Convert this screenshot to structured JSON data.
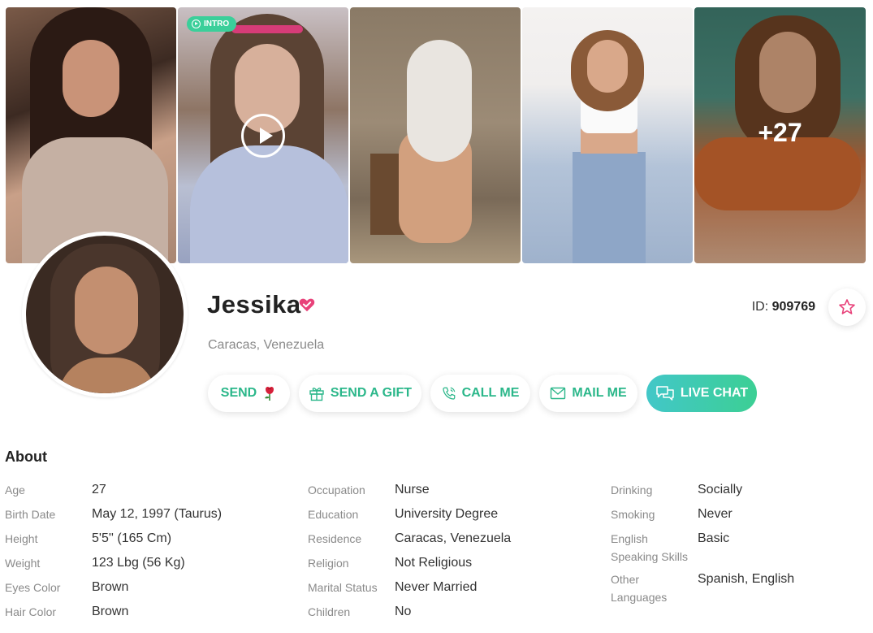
{
  "gallery": {
    "intro_badge": "INTRO",
    "more_count": "+27"
  },
  "profile": {
    "name": "Jessika",
    "location": "Caracas, Venezuela",
    "id_label": "ID:",
    "id_value": "909769"
  },
  "actions": {
    "send": "SEND",
    "send_gift": "SEND A GIFT",
    "call_me": "CALL ME",
    "mail_me": "MAIL ME",
    "live_chat": "LIVE CHAT"
  },
  "about": {
    "title": "About",
    "col1": [
      {
        "label": "Age",
        "value": "27"
      },
      {
        "label": "Birth Date",
        "value": "May 12, 1997 (Taurus)"
      },
      {
        "label": "Height",
        "value": "5'5'' (165 Cm)"
      },
      {
        "label": "Weight",
        "value": "123 Lbg (56 Kg)"
      },
      {
        "label": "Eyes Color",
        "value": "Brown"
      },
      {
        "label": "Hair Color",
        "value": "Brown"
      }
    ],
    "col2": [
      {
        "label": "Occupation",
        "value": "Nurse"
      },
      {
        "label": "Education",
        "value": "University Degree"
      },
      {
        "label": "Residence",
        "value": "Caracas, Venezuela"
      },
      {
        "label": "Religion",
        "value": "Not Religious"
      },
      {
        "label": "Marital Status",
        "value": "Never Married"
      },
      {
        "label": "Children",
        "value": "No"
      }
    ],
    "col3": [
      {
        "label": "Drinking",
        "value": "Socially"
      },
      {
        "label": "Smoking",
        "value": "Never"
      },
      {
        "label": "English Speaking Skills",
        "value": "Basic"
      },
      {
        "label": "Other Languages",
        "value": "Spanish, English"
      }
    ]
  },
  "colors": {
    "accent_green": "#2bb78a",
    "brand_pink": "#e8427a",
    "chat_gradient_start": "#42c7c8",
    "chat_gradient_end": "#3ccf94"
  },
  "icons": [
    "play-icon",
    "verified-heart-icon",
    "star-icon",
    "rose-icon",
    "gift-icon",
    "phone-icon",
    "mail-icon",
    "chat-icon"
  ]
}
